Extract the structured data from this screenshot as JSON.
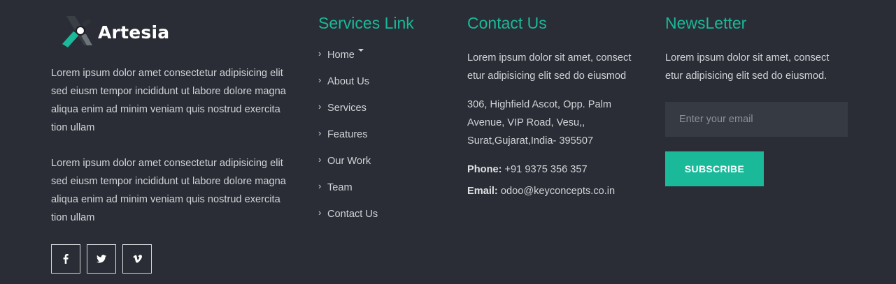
{
  "brand": {
    "name": "Artesia"
  },
  "about": {
    "paragraph_1": "Lorem ipsum dolor amet consectetur adipisicing elit sed eiusm tempor incididunt ut labore dolore magna aliqua enim ad minim veniam quis nostrud exercita tion ullam",
    "paragraph_2": "Lorem ipsum dolor amet consectetur adipisicing elit sed eiusm tempor incididunt ut labore dolore magna aliqua enim ad minim veniam quis nostrud exercita tion ullam",
    "social": [
      {
        "icon": "facebook-icon"
      },
      {
        "icon": "twitter-icon"
      },
      {
        "icon": "vimeo-icon"
      }
    ]
  },
  "services": {
    "title": "Services Link",
    "links": [
      "Home",
      "About Us",
      "Services",
      "Features",
      "Our Work",
      "Team",
      "Contact Us"
    ]
  },
  "contact": {
    "title": "Contact Us",
    "intro": "Lorem ipsum dolor sit amet, consect etur adipisicing elit sed do eiusmod",
    "address": "306, Highfield Ascot, Opp. Palm Avenue, VIP Road, Vesu,, Surat,Gujarat,India- 395507",
    "phone_label": "Phone:",
    "phone": "+91 9375 356 357",
    "email_label": "Email:",
    "email": "odoo@keyconcepts.co.in"
  },
  "newsletter": {
    "title": "NewsLetter",
    "intro": "Lorem ipsum dolor sit amet, consect etur adipisicing elit sed do eiusmod.",
    "email_placeholder": "Enter your email",
    "subscribe_label": "SUBSCRIBE"
  },
  "colors": {
    "background": "#2a2d35",
    "accent": "#19b99a",
    "input_bg": "#363b43"
  }
}
